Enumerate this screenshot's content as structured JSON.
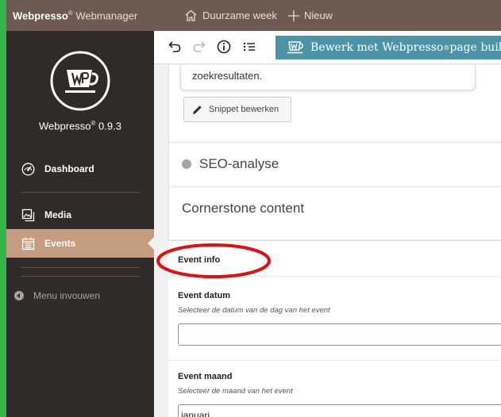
{
  "topbar": {
    "brand_bold": "Webpresso",
    "brand_reg": "®",
    "brand_rest": " Webmanager",
    "site_name": "Duurzame week",
    "new_label": "Nieuw"
  },
  "sidebar": {
    "logo_text": "Webpresso",
    "logo_reg": "®",
    "version": " 0.9.3",
    "items": [
      {
        "label": "Dashboard",
        "icon": "dashboard-icon"
      },
      {
        "label": "Media",
        "icon": "media-icon"
      },
      {
        "label": "Events",
        "icon": "calendar-icon",
        "active": true
      }
    ],
    "collapse_label": "Menu invouwen"
  },
  "toolbar": {
    "builder_prefix": "Bewerk met Webpresso",
    "builder_reg": "®",
    "builder_suffix": " page builder"
  },
  "yoast": {
    "snippet_text": "zoekresultaten.",
    "snippet_button": "Snippet bewerken",
    "seo_label": "SEO-analyse",
    "cornerstone_label": "Cornerstone content"
  },
  "acf": {
    "title": "Event info",
    "fields": [
      {
        "label": "Event datum",
        "description": "Selecteer de datum van de dag van het event",
        "value": ""
      },
      {
        "label": "Event maand",
        "description": "Selecteer de maand van het event",
        "value": "januari"
      }
    ]
  },
  "colors": {
    "topbar": "#6d5a52",
    "sidebar": "#2f2b2b",
    "active": "#c59c7e",
    "builder_button": "#4d93a8",
    "annotation": "#e01010",
    "border": "#33b54a"
  }
}
